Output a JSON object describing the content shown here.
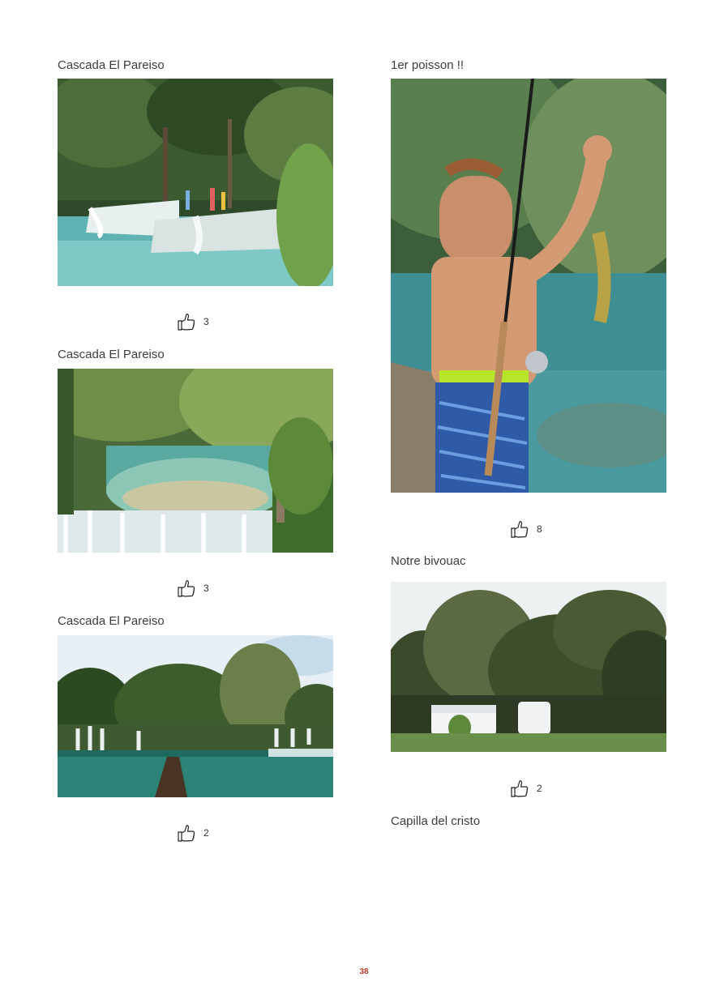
{
  "left_column": [
    {
      "title": "Cascada El Pareiso",
      "likes": "3",
      "photo_icon": "waterfall-photo"
    },
    {
      "title": "Cascada El Pareiso",
      "likes": "3",
      "photo_icon": "waterfall-pools-photo"
    },
    {
      "title": "Cascada El Pareiso",
      "likes": "2",
      "photo_icon": "waterfall-landscape-photo"
    }
  ],
  "right_column": [
    {
      "title": "1er poisson !!",
      "likes": "8",
      "photo_icon": "boy-fishing-photo"
    },
    {
      "title": "Notre bivouac",
      "likes": "2",
      "photo_icon": "campers-photo"
    },
    {
      "title": "Capilla del cristo"
    }
  ],
  "icons": {
    "like": "thumbs-up-icon"
  },
  "colors": {
    "page_number": "#c0392b",
    "text": "#3d3d3d"
  },
  "page": {
    "number": "38"
  }
}
